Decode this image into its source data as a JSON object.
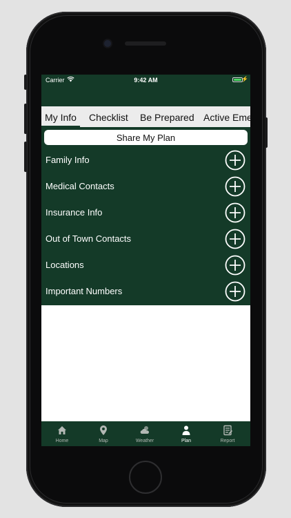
{
  "status_bar": {
    "carrier": "Carrier",
    "time": "9:42 AM"
  },
  "tabs": [
    {
      "label": "My Info",
      "active": true
    },
    {
      "label": "Checklist",
      "active": false
    },
    {
      "label": "Be Prepared",
      "active": false
    },
    {
      "label": "Active Emer",
      "active": false
    }
  ],
  "share_button": {
    "label": "Share My Plan"
  },
  "plan_sections": [
    {
      "label": "Family Info",
      "icon": "plus-circle-icon"
    },
    {
      "label": "Medical Contacts",
      "icon": "plus-circle-icon"
    },
    {
      "label": "Insurance Info",
      "icon": "plus-circle-icon"
    },
    {
      "label": "Out of Town Contacts",
      "icon": "plus-circle-icon"
    },
    {
      "label": "Locations",
      "icon": "plus-circle-icon"
    },
    {
      "label": "Important Numbers",
      "icon": "plus-circle-icon"
    }
  ],
  "tab_bar": [
    {
      "label": "Home",
      "icon": "home-icon",
      "active": false
    },
    {
      "label": "Map",
      "icon": "map-pin-icon",
      "active": false
    },
    {
      "label": "Weather",
      "icon": "weather-icon",
      "active": false
    },
    {
      "label": "Plan",
      "icon": "person-icon",
      "active": true
    },
    {
      "label": "Report",
      "icon": "report-icon",
      "active": false
    }
  ],
  "colors": {
    "brand_green": "#143a28",
    "tab_background": "#ececec",
    "battery": "#4cd964"
  }
}
